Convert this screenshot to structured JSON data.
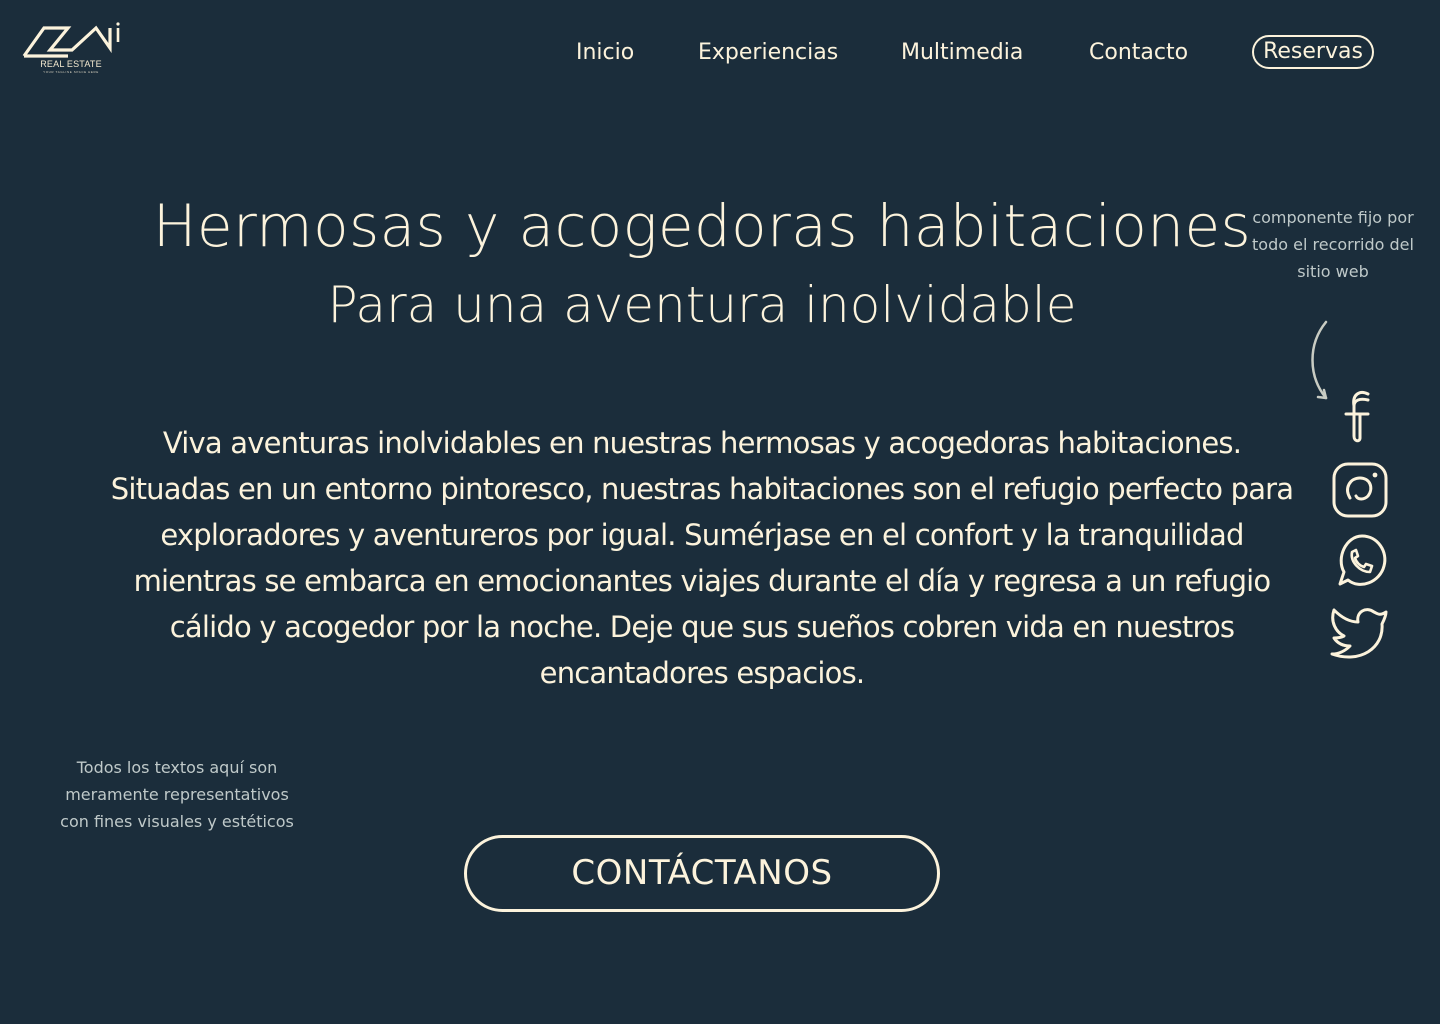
{
  "brand": {
    "name": "REAL ESTATE",
    "tagline": "YOUR TAGLINE SPACE HERE"
  },
  "nav": {
    "items": [
      {
        "label": "Inicio"
      },
      {
        "label": "Experiencias"
      },
      {
        "label": "Multimedia"
      },
      {
        "label": "Contacto"
      }
    ],
    "cta_label": "Reservas"
  },
  "hero": {
    "title": "Hermosas y acogedoras habitaciones",
    "subtitle": "Para una aventura inolvidable",
    "body": "Viva aventuras inolvidables en nuestras hermosas y acogedoras habitaciones. Situadas en un entorno pintoresco, nuestras habitaciones son el refugio perfecto para exploradores y aventureros por igual. Sumérjase en el confort y la tranquilidad mientras se embarca en emocionantes viajes durante el día y regresa a un refugio cálido y acogedor por la noche. Deje que sus sueños cobren vida en nuestros encantadores espacios.",
    "cta_label": "CONTÁCTANOS"
  },
  "annotations": {
    "fixed_component": "componente fijo por todo el recorrido del sitio web",
    "disclaimer": "Todos los textos aquí son meramente representativos con fines visuales y estéticos"
  },
  "social": [
    {
      "icon": "facebook-icon"
    },
    {
      "icon": "instagram-icon"
    },
    {
      "icon": "whatsapp-icon"
    },
    {
      "icon": "twitter-icon"
    }
  ],
  "colors": {
    "background": "#1b2d3b",
    "foreground": "#fcf3dc",
    "note": "#bfc9c9"
  }
}
